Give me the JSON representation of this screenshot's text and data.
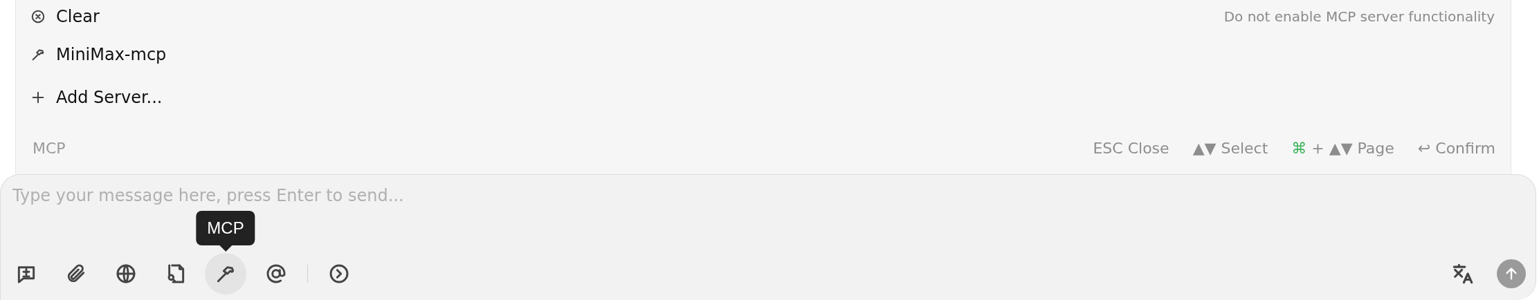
{
  "menu": {
    "items": [
      {
        "kind": "clear",
        "label": "Clear",
        "description": "Do not enable MCP server functionality",
        "selected": false
      },
      {
        "kind": "server",
        "label": "MiniMax-mcp",
        "selected": false
      },
      {
        "kind": "add",
        "label": "Add Server...",
        "selected": false
      }
    ],
    "footer": {
      "title": "MCP",
      "hints": [
        {
          "keys": "ESC",
          "label": "Close"
        },
        {
          "keys": "▲▼",
          "label": "Select"
        },
        {
          "accent": "⌘",
          "keys": "+ ▲▼",
          "label": "Page"
        },
        {
          "keys": "↩",
          "label": "Confirm"
        }
      ]
    }
  },
  "composer": {
    "placeholder": "Type your message here, press Enter to send...",
    "tools": [
      {
        "kind": "new-topic",
        "active": false
      },
      {
        "kind": "attach",
        "active": false
      },
      {
        "kind": "web",
        "active": false
      },
      {
        "kind": "file-search",
        "active": false
      },
      {
        "kind": "mcp",
        "active": true,
        "tooltip": "MCP"
      },
      {
        "kind": "mention",
        "active": false
      },
      {
        "kind": "separator"
      },
      {
        "kind": "more",
        "active": false
      }
    ],
    "right_tools": [
      {
        "kind": "translate"
      },
      {
        "kind": "send"
      }
    ]
  }
}
